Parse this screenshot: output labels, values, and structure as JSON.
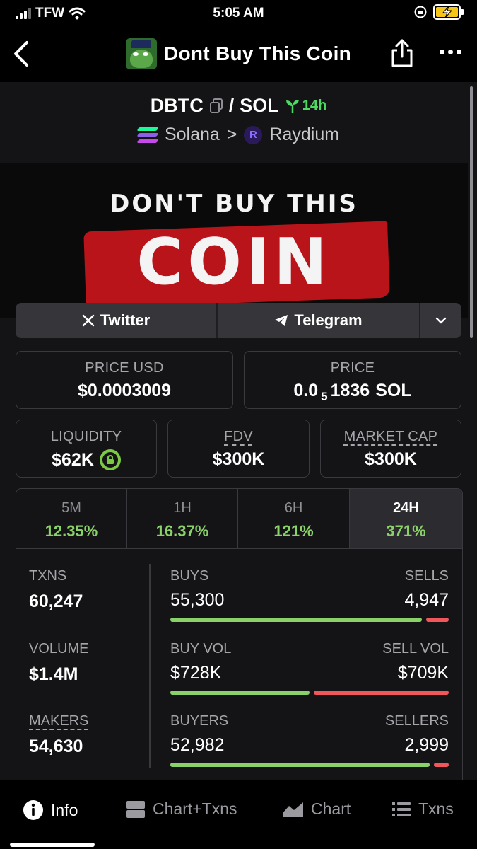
{
  "status": {
    "carrier": "TFW",
    "time": "5:05 AM"
  },
  "nav": {
    "title": "Dont Buy This Coin"
  },
  "pair": {
    "base": "DBTC",
    "separator": "/",
    "quote": "SOL",
    "age": "14h"
  },
  "chain": {
    "network": "Solana",
    "arrow": ">",
    "dex": "Raydium",
    "dex_letter": "R"
  },
  "banner": {
    "headline": "DON'T BUY THIS",
    "word": "COIN"
  },
  "links": {
    "twitter": "Twitter",
    "telegram": "Telegram"
  },
  "price_usd": {
    "label": "PRICE USD",
    "value": "$0.0003009"
  },
  "price_native": {
    "label": "PRICE",
    "prefix": "0.0",
    "sub": "5",
    "digits": "1836",
    "unit": "SOL"
  },
  "liquidity": {
    "label": "LIQUIDITY",
    "value": "$62K"
  },
  "fdv": {
    "label": "FDV",
    "value": "$300K"
  },
  "market_cap": {
    "label": "MARKET CAP",
    "value": "$300K"
  },
  "timeframes": [
    {
      "label": "5M",
      "change": "12.35%"
    },
    {
      "label": "1H",
      "change": "16.37%"
    },
    {
      "label": "6H",
      "change": "121%"
    },
    {
      "label": "24H",
      "change": "371%"
    }
  ],
  "stats": {
    "txns": {
      "label": "TXNS",
      "value": "60,247"
    },
    "volume": {
      "label": "VOLUME",
      "value": "$1.4M"
    },
    "makers": {
      "label": "MAKERS",
      "value": "54,630"
    },
    "buys": {
      "label": "BUYS",
      "value": "55,300",
      "sell_label": "SELLS",
      "sell_value": "4,947",
      "buy_fraction": 0.918
    },
    "buy_vol": {
      "label": "BUY VOL",
      "value": "$728K",
      "sell_label": "SELL VOL",
      "sell_value": "$709K",
      "buy_fraction": 0.507
    },
    "buyers": {
      "label": "BUYERS",
      "value": "52,982",
      "sell_label": "SELLERS",
      "sell_value": "2,999",
      "buy_fraction": 0.946
    }
  },
  "tabs": {
    "info": "Info",
    "chart_txns": "Chart+Txns",
    "chart": "Chart",
    "txns": "Txns"
  },
  "colors": {
    "positive": "#8bd16a",
    "negative": "#f0565a",
    "background": "#141416",
    "border": "#3a3a3e"
  },
  "icons": [
    "back-chevron-icon",
    "share-icon",
    "more-icon",
    "copy-icon",
    "sprout-icon",
    "solana-icon",
    "raydium-icon",
    "x-logo-icon",
    "telegram-icon",
    "chevron-down-icon",
    "lock-icon",
    "info-icon",
    "chart-txns-icon",
    "chart-icon",
    "list-icon"
  ]
}
